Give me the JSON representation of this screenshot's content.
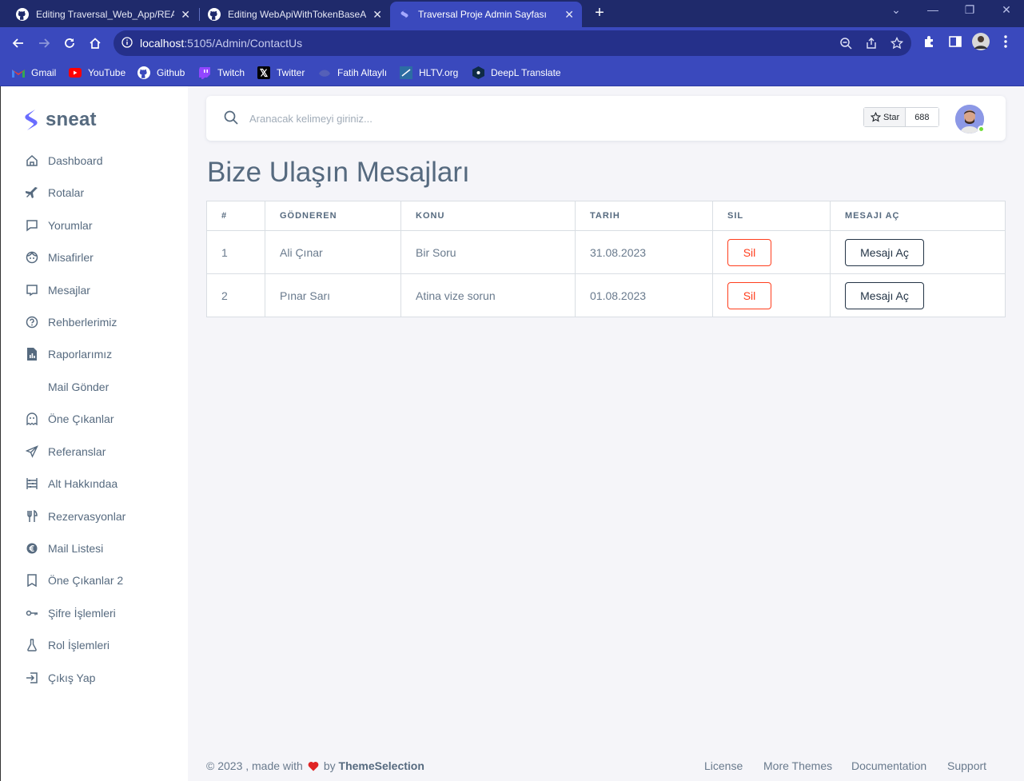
{
  "browser": {
    "tabs": [
      {
        "title": "Editing Traversal_Web_App/READ"
      },
      {
        "title": "Editing WebApiWithTokenBaseAu"
      },
      {
        "title": "Traversal Proje Admin Sayfası"
      }
    ],
    "url_host": "localhost",
    "url_path": ":5105/Admin/ContactUs",
    "bookmarks": [
      {
        "label": "Gmail"
      },
      {
        "label": "YouTube"
      },
      {
        "label": "Github"
      },
      {
        "label": "Twitch"
      },
      {
        "label": "Twitter"
      },
      {
        "label": "Fatih Altaylı"
      },
      {
        "label": "HLTV.org"
      },
      {
        "label": "DeepL Translate"
      }
    ]
  },
  "sidebar": {
    "brand": "sneat",
    "items": [
      {
        "label": "Dashboard",
        "icon": "home-icon"
      },
      {
        "label": "Rotalar",
        "icon": "plane-icon"
      },
      {
        "label": "Yorumlar",
        "icon": "comment-icon"
      },
      {
        "label": "Misafirler",
        "icon": "face-icon"
      },
      {
        "label": "Mesajlar",
        "icon": "message-icon"
      },
      {
        "label": "Rehberlerimiz",
        "icon": "help-icon"
      },
      {
        "label": "Raporlarımız",
        "icon": "report-icon"
      },
      {
        "label": "Mail Gönder",
        "icon": ""
      },
      {
        "label": "Öne Çıkanlar",
        "icon": "ghost-icon"
      },
      {
        "label": "Referanslar",
        "icon": "send-icon"
      },
      {
        "label": "Alt Hakkındaa",
        "icon": "abacus-icon"
      },
      {
        "label": "Rezervasyonlar",
        "icon": "restaurant-icon"
      },
      {
        "label": "Mail Listesi",
        "icon": "euro-icon"
      },
      {
        "label": "Öne Çıkanlar 2",
        "icon": "book-icon"
      },
      {
        "label": "Şifre İşlemleri",
        "icon": "key-icon"
      },
      {
        "label": "Rol İşlemleri",
        "icon": "flask-icon"
      },
      {
        "label": "Çıkış Yap",
        "icon": "logout-icon"
      }
    ]
  },
  "topnav": {
    "search_placeholder": "Aranacak kelimeyi giriniz...",
    "star_label": "Star",
    "star_count": "688"
  },
  "page": {
    "title": "Bize Ulaşın Mesajları"
  },
  "table": {
    "headers": [
      "#",
      "GÖDNEREN",
      "KONU",
      "TARIH",
      "SIL",
      "MESAJI AÇ"
    ],
    "rows": [
      {
        "num": "1",
        "sender": "Ali Çınar",
        "subject": "Bir Soru",
        "date": "31.08.2023",
        "delete": "Sil",
        "open": "Mesajı Aç"
      },
      {
        "num": "2",
        "sender": "Pınar Sarı",
        "subject": "Atina vize sorun",
        "date": "01.08.2023",
        "delete": "Sil",
        "open": "Mesajı Aç"
      }
    ]
  },
  "footer": {
    "copyright": "© 2023 , made with",
    "by": "by",
    "brand": "ThemeSelection",
    "links": [
      "License",
      "More Themes",
      "Documentation",
      "Support"
    ]
  },
  "colors": {
    "primary": "#696cff",
    "danger": "#ff3e1d",
    "text": "#566a7f",
    "browser_tab_bg": "#1f2a6b",
    "browser_toolbar_bg": "#3a49bd"
  }
}
